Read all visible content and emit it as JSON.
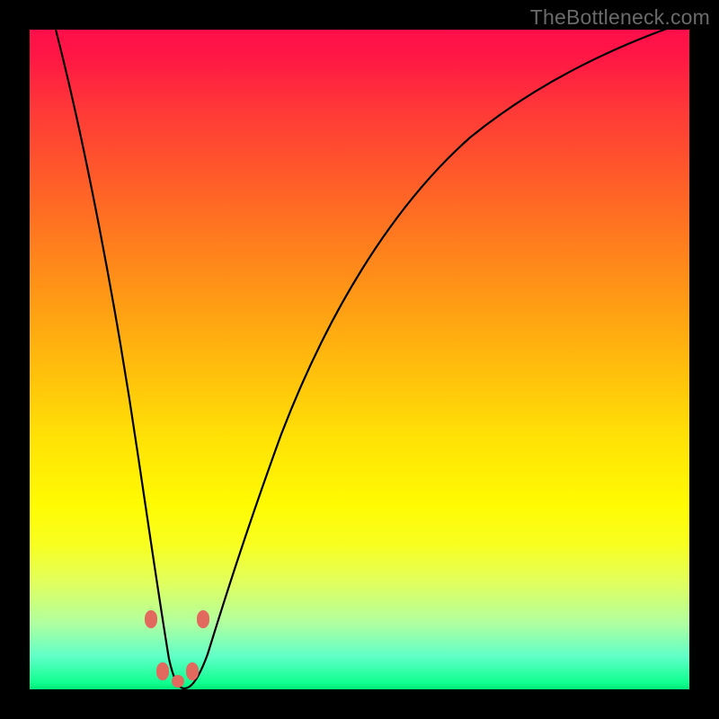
{
  "watermark": "TheBottleneck.com",
  "chart_data": {
    "type": "line",
    "title": "",
    "xlabel": "",
    "ylabel": "",
    "xlim": [
      0,
      100
    ],
    "ylim": [
      0,
      100
    ],
    "grid": false,
    "legend": false,
    "background_gradient": {
      "top_color": "#ff0f4a",
      "bottom_color": "#00e878",
      "meaning": "red = high bottleneck, green = no bottleneck"
    },
    "series": [
      {
        "name": "bottleneck-curve",
        "color": "#000000",
        "x": [
          4,
          6,
          8,
          10,
          12,
          14,
          16,
          18,
          19,
          20,
          21,
          22,
          23,
          24,
          25,
          27,
          30,
          34,
          40,
          48,
          58,
          70,
          84,
          100
        ],
        "y": [
          100,
          88,
          76,
          64,
          52,
          40,
          28,
          16,
          11,
          7,
          3,
          1,
          0,
          0,
          1,
          4,
          11,
          22,
          36,
          51,
          64,
          75,
          83,
          89
        ]
      }
    ],
    "markers": [
      {
        "name": "optimum-beads",
        "shape": "rounded-rect",
        "color": "#e2695e",
        "points": [
          {
            "x": 18.5,
            "y": 11
          },
          {
            "x": 19.8,
            "y": 3
          },
          {
            "x": 22.3,
            "y": 1
          },
          {
            "x": 24.3,
            "y": 3
          },
          {
            "x": 25.5,
            "y": 11
          }
        ]
      }
    ],
    "minimum": {
      "x": 22.5,
      "y": 0
    }
  }
}
